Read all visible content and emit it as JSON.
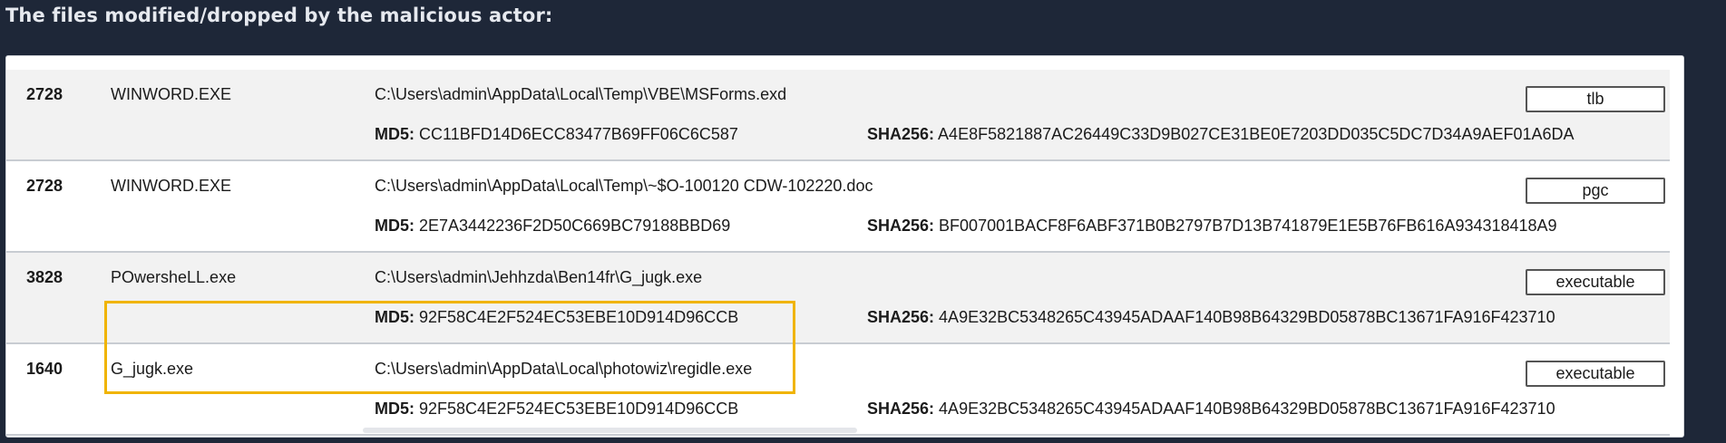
{
  "caption": "The files modified/dropped by the malicious actor:",
  "labels": {
    "md5": "MD5:",
    "sha256": "SHA256:"
  },
  "rows": [
    {
      "pid": "2728",
      "process": "WINWORD.EXE",
      "path": "C:\\Users\\admin\\AppData\\Local\\Temp\\VBE\\MSForms.exd",
      "md5": "CC11BFD14D6ECC83477B69FF06C6C587",
      "sha256": "A4E8F5821887AC26449C33D9B027CE31BE0E7203DD035C5DC7D34A9AEF01A6DA",
      "type": "tlb"
    },
    {
      "pid": "2728",
      "process": "WINWORD.EXE",
      "path": "C:\\Users\\admin\\AppData\\Local\\Temp\\~$O-100120 CDW-102220.doc",
      "md5": "2E7A3442236F2D50C669BC79188BBD69",
      "sha256": "BF007001BACF8F6ABF371B0B2797B7D13B741879E1E5B76FB616A934318418A9",
      "type": "pgc"
    },
    {
      "pid": "3828",
      "process": "POwersheLL.exe",
      "path": "C:\\Users\\admin\\Jehhzda\\Ben14fr\\G_jugk.exe",
      "md5": "92F58C4E2F524EC53EBE10D914D96CCB",
      "sha256": "4A9E32BC5348265C43945ADAAF140B98B64329BD05878BC13671FA916F423710",
      "type": "executable"
    },
    {
      "pid": "1640",
      "process": "G_jugk.exe",
      "path": "C:\\Users\\admin\\AppData\\Local\\photowiz\\regidle.exe",
      "md5": "92F58C4E2F524EC53EBE10D914D96CCB",
      "sha256": "4A9E32BC5348265C43945ADAAF140B98B64329BD05878BC13671FA916F423710",
      "type": "executable"
    }
  ],
  "colors": {
    "highlight": "#f0b400",
    "background": "#1e2738"
  }
}
